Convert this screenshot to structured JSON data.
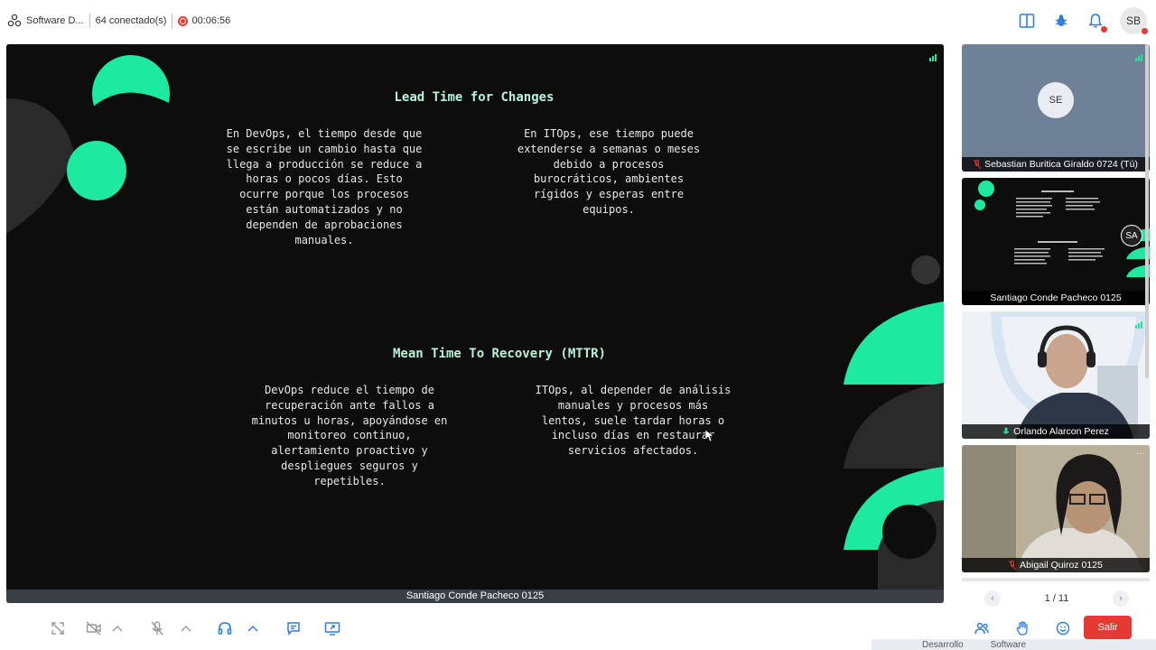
{
  "topbar": {
    "app_title": "Software D...",
    "connected": "64 conectado(s)",
    "recording_time": "00:06:56",
    "user_initials": "SB",
    "icons": [
      "org-icon",
      "layout-icon",
      "bug-icon",
      "bell-icon"
    ]
  },
  "slide": {
    "section1": {
      "title": "Lead Time for Changes",
      "left_text": [
        "En DevOps, el tiempo desde que",
        "se escribe un cambio hasta que",
        "llega a producción se reduce a",
        "horas o pocos días. Esto",
        "ocurre porque los procesos",
        "están automatizados y no",
        "dependen de aprobaciones",
        "manuales."
      ],
      "right_text": [
        "En ITOps, ese tiempo puede",
        "extenderse a semanas o meses",
        "debido a procesos",
        "burocráticos, ambientes",
        "rígidos y esperas entre",
        "equipos."
      ]
    },
    "section2": {
      "title": "Mean Time To Recovery (MTTR)",
      "left_text": [
        "DevOps reduce el tiempo de",
        "recuperación ante fallos a",
        "minutos u horas, apoyándose en",
        "monitoreo continuo,",
        "alertamiento proactivo y",
        "despliegues seguros y",
        "repetibles."
      ],
      "right_text": [
        "ITOps, al depender de análisis",
        "manuales y procesos más",
        "lentos, suele tardar horas o",
        "incluso días en restaurar",
        "servicios afectados."
      ]
    },
    "presenter": "Santiago Conde Pacheco 0125",
    "accent_color": "#1de9a0"
  },
  "participants": [
    {
      "initials": "SE",
      "name": "Sebastian Buritica Giraldo 0724 (Tú)",
      "mic": "muted"
    },
    {
      "initials": "SA",
      "name": "Santiago Conde Pacheco 0125",
      "mic": "none"
    },
    {
      "initials": "",
      "name": "Orlando Alarcon Perez",
      "mic": "on"
    },
    {
      "initials": "",
      "name": "Abigail Quiroz 0125",
      "mic": "muted"
    }
  ],
  "pager": {
    "label": "1 / 11"
  },
  "controls": {
    "leave_label": "Salir",
    "icons": [
      "fullscreen-icon",
      "camera-off-icon",
      "mic-off-icon",
      "headset-icon",
      "chat-icon",
      "share-screen-icon",
      "people-icon",
      "raise-hand-icon",
      "emoji-icon"
    ]
  },
  "taskbar": {
    "items": [
      "Desarrollo",
      "Software"
    ]
  }
}
